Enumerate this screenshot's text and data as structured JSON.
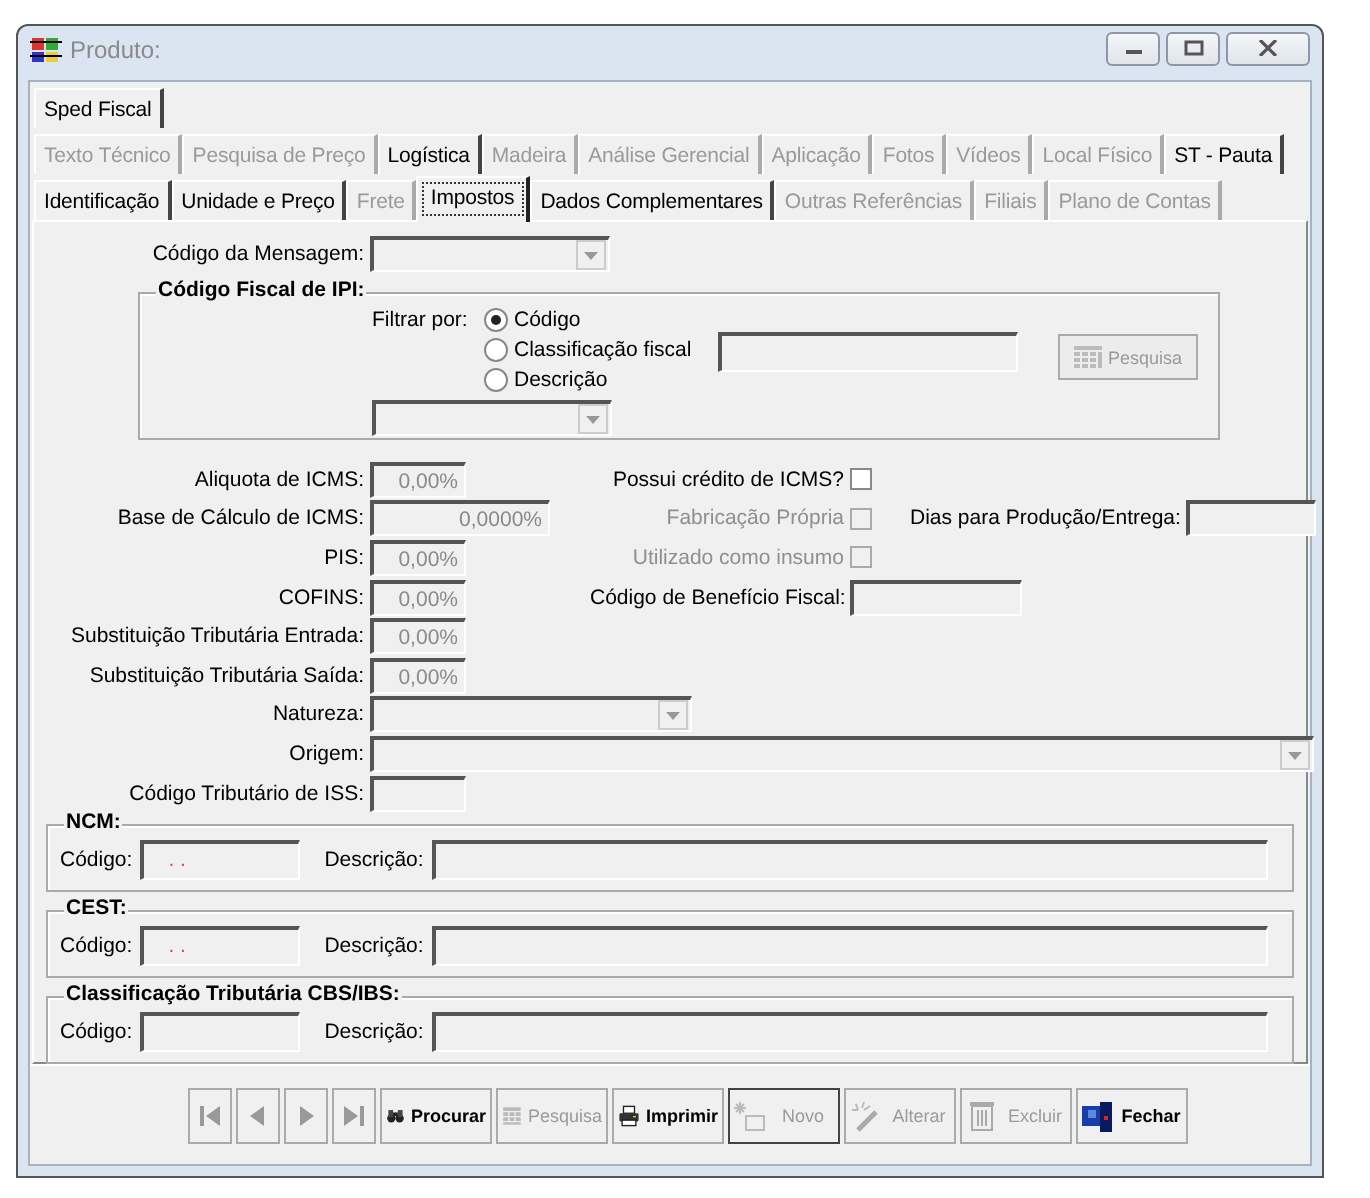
{
  "window": {
    "title": "Produto:"
  },
  "tab_rows": [
    [
      {
        "label": "Sped Fiscal",
        "disabled": false,
        "selected": false
      }
    ],
    [
      {
        "label": "Texto Técnico",
        "disabled": true,
        "selected": false
      },
      {
        "label": "Pesquisa de Preço",
        "disabled": true,
        "selected": false
      },
      {
        "label": "Logística",
        "disabled": false,
        "selected": false
      },
      {
        "label": "Madeira",
        "disabled": true,
        "selected": false
      },
      {
        "label": "Análise Gerencial",
        "disabled": true,
        "selected": false
      },
      {
        "label": "Aplicação",
        "disabled": true,
        "selected": false
      },
      {
        "label": "Fotos",
        "disabled": true,
        "selected": false
      },
      {
        "label": "Vídeos",
        "disabled": true,
        "selected": false
      },
      {
        "label": "Local Físico",
        "disabled": true,
        "selected": false
      },
      {
        "label": "ST - Pauta",
        "disabled": false,
        "selected": false
      }
    ],
    [
      {
        "label": "Identificação",
        "disabled": false,
        "selected": false
      },
      {
        "label": "Unidade e Preço",
        "disabled": false,
        "selected": false
      },
      {
        "label": "Frete",
        "disabled": true,
        "selected": false
      },
      {
        "label": "Impostos",
        "disabled": false,
        "selected": true
      },
      {
        "label": "Dados Complementares",
        "disabled": false,
        "selected": false
      },
      {
        "label": "Outras Referências",
        "disabled": true,
        "selected": false
      },
      {
        "label": "Filiais",
        "disabled": true,
        "selected": false
      },
      {
        "label": "Plano de Contas",
        "disabled": true,
        "selected": false
      }
    ]
  ],
  "message_code": {
    "label": "Código da Mensagem:"
  },
  "ipi_group": {
    "title": "Código Fiscal de IPI:",
    "filter_label": "Filtrar por:",
    "options": [
      {
        "label": "Código",
        "selected": true
      },
      {
        "label": "Classificação fiscal",
        "selected": false
      },
      {
        "label": "Descrição",
        "selected": false
      }
    ],
    "search_button": {
      "label": "Pesquisa",
      "disabled": true
    }
  },
  "rows": [
    {
      "label": "Aliquota de ICMS:",
      "kind": "field",
      "value": "0,00%",
      "right": [
        {
          "kind": "checkbox",
          "label": "Possui crédito de ICMS?",
          "checked": false,
          "disabled": false
        }
      ]
    },
    {
      "label": "Base de Cálculo de ICMS:",
      "kind": "wide-field",
      "value": "0,0000%",
      "right": [
        {
          "kind": "checkbox",
          "label": "Fabricação Própria",
          "checked": false,
          "disabled": true
        },
        {
          "kind": "field",
          "label": "Dias para Produção/Entrega:"
        }
      ]
    },
    {
      "label": "PIS:",
      "kind": "field",
      "value": "0,00%",
      "right": [
        {
          "kind": "checkbox",
          "label": "Utilizado como insumo",
          "checked": false,
          "disabled": true
        }
      ]
    },
    {
      "label": "COFINS:",
      "kind": "field",
      "value": "0,00%",
      "right": [
        {
          "kind": "field",
          "label": "Código de Benefício Fiscal:"
        }
      ]
    },
    {
      "label": "Substituição Tributária Entrada:",
      "kind": "field",
      "value": "0,00%"
    },
    {
      "label": "Substituição Tributária Saída:",
      "kind": "field",
      "value": "0,00%"
    },
    {
      "label": "Natureza:",
      "kind": "combo"
    },
    {
      "label": "Origem:",
      "kind": "long-combo"
    },
    {
      "label": "Código Tributário de ISS:",
      "kind": "field"
    }
  ],
  "groups": [
    {
      "title": "NCM:",
      "code_label": "Código:",
      "code_value": ".  .",
      "description_label": "Descrição:"
    },
    {
      "title": "CEST:",
      "code_label": "Código:",
      "code_value": ".  .",
      "description_label": "Descrição:"
    },
    {
      "title": "Classificação Tributária CBS/IBS:",
      "code_label": "Código:",
      "description_label": "Descrição:"
    }
  ],
  "nav_buttons": [
    {
      "disabled": true
    },
    {
      "disabled": true
    },
    {
      "disabled": true
    },
    {
      "disabled": true
    }
  ],
  "buttons": [
    {
      "label": "Procurar",
      "disabled": false,
      "focused": false
    },
    {
      "label": "Pesquisa",
      "disabled": true,
      "focused": false
    },
    {
      "label": "Imprimir",
      "disabled": false,
      "focused": false
    },
    {
      "label": "Novo",
      "disabled": true,
      "focused": true
    },
    {
      "label": "Alterar",
      "disabled": true,
      "focused": false
    },
    {
      "label": "Excluir",
      "disabled": true,
      "focused": false
    },
    {
      "label": "Fechar",
      "disabled": false,
      "focused": false
    }
  ]
}
